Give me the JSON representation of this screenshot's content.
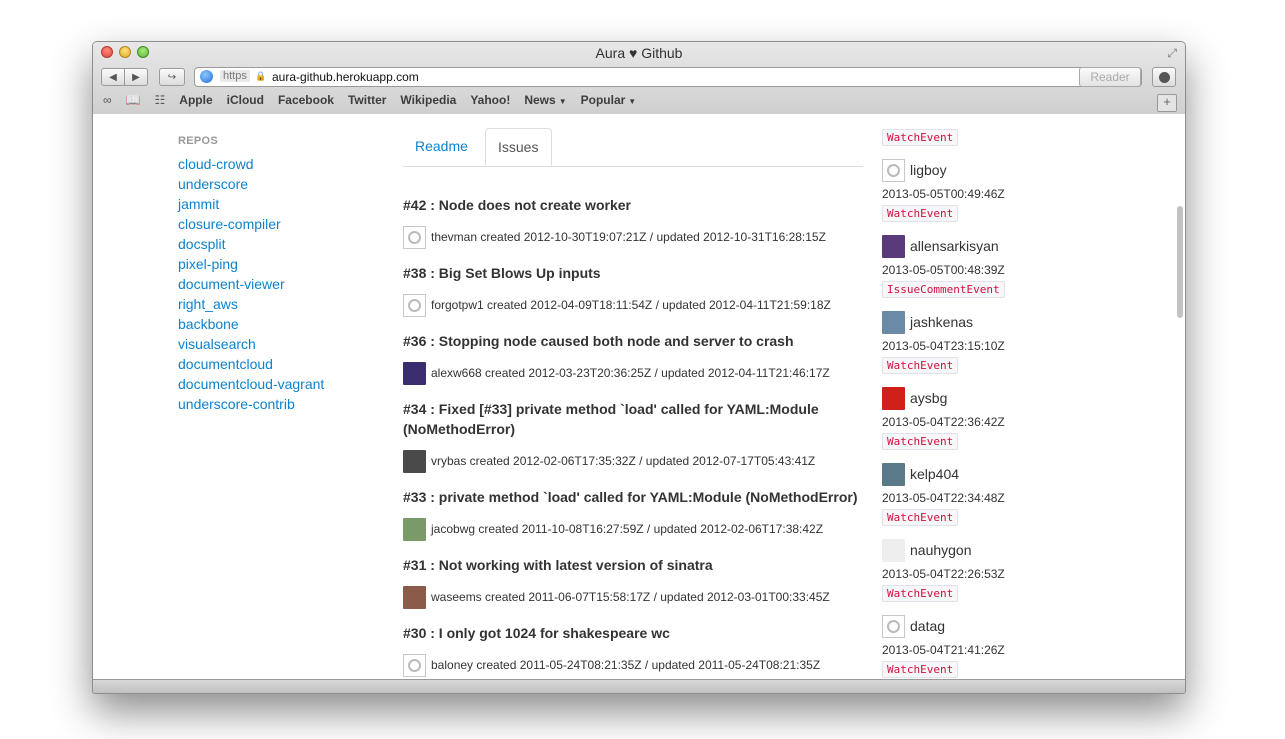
{
  "window": {
    "title": "Aura ♥ Github"
  },
  "toolbar": {
    "url_scheme": "https",
    "url": "aura-github.herokuapp.com",
    "reader_label": "Reader"
  },
  "bookmarks": [
    "Apple",
    "iCloud",
    "Facebook",
    "Twitter",
    "Wikipedia",
    "Yahoo!",
    "News",
    "Popular"
  ],
  "sidebar": {
    "heading": "REPOS",
    "repos": [
      "cloud-crowd",
      "underscore",
      "jammit",
      "closure-compiler",
      "docsplit",
      "pixel-ping",
      "document-viewer",
      "right_aws",
      "backbone",
      "visualsearch",
      "documentcloud",
      "documentcloud-vagrant",
      "underscore-contrib"
    ]
  },
  "tabs": {
    "readme": "Readme",
    "issues": "Issues"
  },
  "issues": [
    {
      "title": "#42 : Node does not create worker",
      "meta": "thevman created 2012-10-30T19:07:21Z / updated 2012-10-31T16:28:15Z",
      "avatar": "github-default",
      "color": ""
    },
    {
      "title": "#38 : Big Set Blows Up inputs",
      "meta": "forgotpw1 created 2012-04-09T18:11:54Z / updated 2012-04-11T21:59:18Z",
      "avatar": "github-default",
      "color": ""
    },
    {
      "title": "#36 : Stopping node caused both node and server to crash",
      "meta": "alexw668 created 2012-03-23T20:36:25Z / updated 2012-04-11T21:46:17Z",
      "avatar": "photo",
      "color": "#3b2d6e"
    },
    {
      "title": "#34 : Fixed [#33] private method `load' called for YAML:Module (NoMethodError)",
      "meta": "vrybas created 2012-02-06T17:35:32Z / updated 2012-07-17T05:43:41Z",
      "avatar": "photo",
      "color": "#4a4a4a"
    },
    {
      "title": "#33 : private method `load' called for YAML:Module (NoMethodError)",
      "meta": "jacobwg created 2011-10-08T16:27:59Z / updated 2012-02-06T17:38:42Z",
      "avatar": "photo",
      "color": "#7a9a6a"
    },
    {
      "title": "#31 : Not working with latest version of sinatra",
      "meta": "waseems created 2011-06-07T15:58:17Z / updated 2012-03-01T00:33:45Z",
      "avatar": "photo",
      "color": "#8a5a4a"
    },
    {
      "title": "#30 : I only got 1024 for shakespeare wc",
      "meta": "baloney created 2011-05-24T08:21:35Z / updated 2011-05-24T08:21:35Z",
      "avatar": "github-default",
      "color": ""
    }
  ],
  "feed": {
    "top_event": "WatchEvent",
    "items": [
      {
        "user": "ligboy",
        "time": "2013-05-05T00:49:46Z",
        "event": "WatchEvent",
        "avatar": "github-default",
        "color": ""
      },
      {
        "user": "allensarkisyan",
        "time": "2013-05-05T00:48:39Z",
        "event": "IssueCommentEvent",
        "avatar": "photo",
        "color": "#5a3a7a"
      },
      {
        "user": "jashkenas",
        "time": "2013-05-04T23:15:10Z",
        "event": "WatchEvent",
        "avatar": "photo",
        "color": "#6a8aa8"
      },
      {
        "user": "aysbg",
        "time": "2013-05-04T22:36:42Z",
        "event": "WatchEvent",
        "avatar": "photo",
        "color": "#d0201a"
      },
      {
        "user": "kelp404",
        "time": "2013-05-04T22:34:48Z",
        "event": "WatchEvent",
        "avatar": "photo",
        "color": "#5a7a8a"
      },
      {
        "user": "nauhygon",
        "time": "2013-05-04T22:26:53Z",
        "event": "WatchEvent",
        "avatar": "photo",
        "color": "#eeeeee"
      },
      {
        "user": "datag",
        "time": "2013-05-04T21:41:26Z",
        "event": "WatchEvent",
        "avatar": "github-default",
        "color": ""
      }
    ]
  }
}
